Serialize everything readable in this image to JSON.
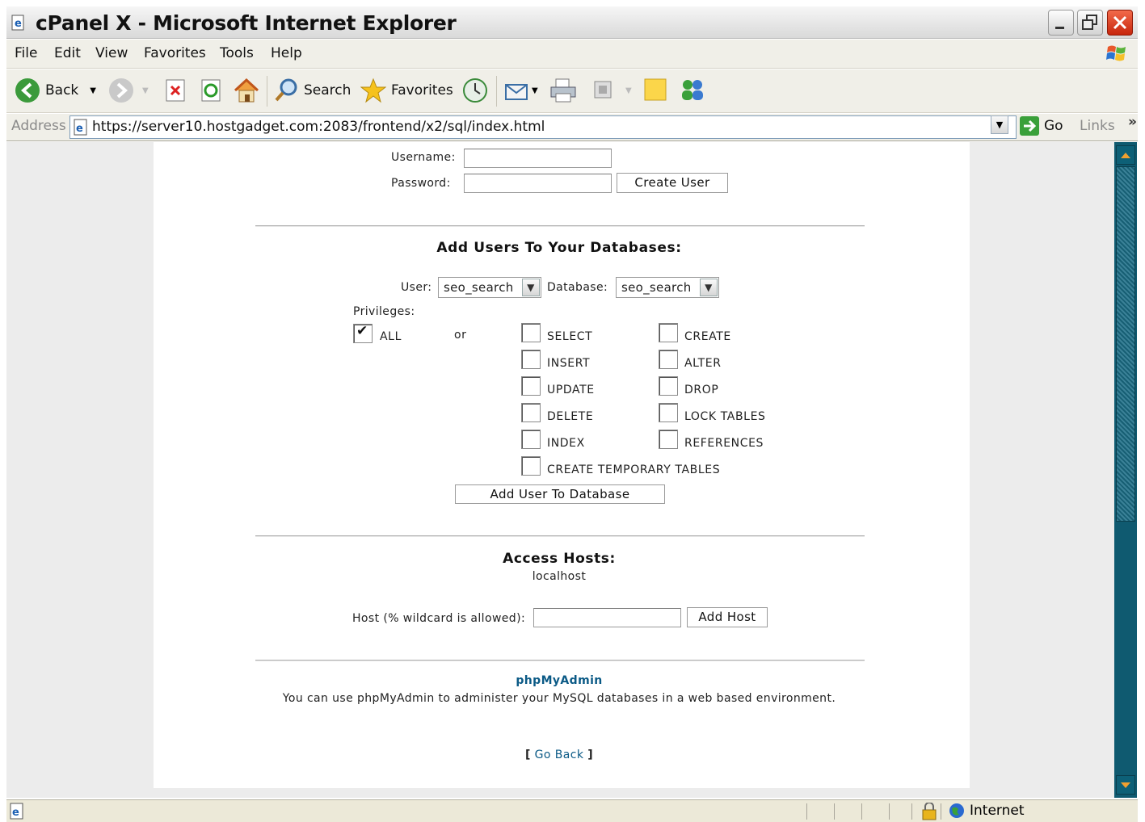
{
  "window": {
    "title": "cPanel X - Microsoft Internet Explorer"
  },
  "menu": [
    "File",
    "Edit",
    "View",
    "Favorites",
    "Tools",
    "Help"
  ],
  "toolbar": {
    "back": "Back",
    "search": "Search",
    "favorites": "Favorites"
  },
  "address": {
    "label": "Address",
    "url": "https://server10.hostgadget.com:2083/frontend/x2/sql/index.html",
    "go": "Go",
    "links": "Links"
  },
  "create_user": {
    "username_label": "Username:",
    "password_label": "Password:",
    "username_value": "",
    "password_value": "",
    "button": "Create User"
  },
  "add_users": {
    "heading": "Add Users To Your Databases:",
    "user_label": "User:",
    "user_value": "seo_search",
    "database_label": "Database:",
    "database_value": "seo_search",
    "privileges_label": "Privileges:",
    "all_label": "ALL",
    "all_checked": true,
    "or_label": "or",
    "privileges": [
      {
        "label": "SELECT",
        "checked": false
      },
      {
        "label": "CREATE",
        "checked": false
      },
      {
        "label": "INSERT",
        "checked": false
      },
      {
        "label": "ALTER",
        "checked": false
      },
      {
        "label": "UPDATE",
        "checked": false
      },
      {
        "label": "DROP",
        "checked": false
      },
      {
        "label": "DELETE",
        "checked": false
      },
      {
        "label": "LOCK TABLES",
        "checked": false
      },
      {
        "label": "INDEX",
        "checked": false
      },
      {
        "label": "REFERENCES",
        "checked": false
      },
      {
        "label": "CREATE TEMPORARY TABLES",
        "checked": false
      }
    ],
    "button": "Add User To Database"
  },
  "access_hosts": {
    "heading": "Access Hosts:",
    "hosts": [
      "localhost"
    ],
    "host_label": "Host (% wildcard is allowed):",
    "host_value": "",
    "button": "Add Host"
  },
  "phpmyadmin": {
    "link": "phpMyAdmin",
    "description": "You can use phpMyAdmin to administer your MySQL databases in a web based environment."
  },
  "go_back": {
    "open": "[",
    "label": "Go Back",
    "close": "]"
  },
  "status": {
    "zone": "Internet"
  },
  "colors": {
    "link": "#0b5a86",
    "scrollbar": "#0f5a70",
    "close_button": "#d9381e"
  }
}
